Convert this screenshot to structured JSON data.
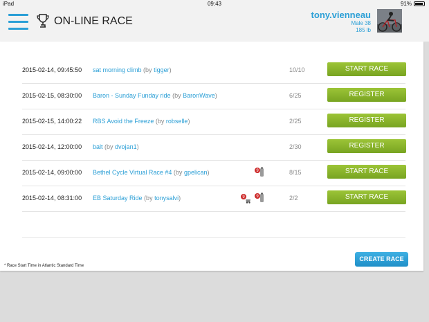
{
  "status_bar": {
    "carrier": "iPad",
    "time": "09:43",
    "battery": "91%"
  },
  "header": {
    "title": "ON-LINE RACE"
  },
  "user": {
    "name": "tony.vienneau",
    "line1": "Male 38",
    "line2": "185 lb"
  },
  "races": [
    {
      "date": "2015-02-14, 09:45:50",
      "name": "sat morning climb",
      "by_prefix": "(by ",
      "by_user": "tigger",
      "by_suffix": ")",
      "count": "10/10",
      "action": "START RACE",
      "icons": []
    },
    {
      "date": "2015-02-15, 08:30:00",
      "name": "Baron - Sunday Funday ride",
      "by_prefix": "(by ",
      "by_user": "BaronWave",
      "by_suffix": ")",
      "count": "6/25",
      "action": "REGISTER",
      "icons": []
    },
    {
      "date": "2015-02-15, 14:00:22",
      "name": "RBS Avoid the Freeze",
      "by_prefix": "(by ",
      "by_user": "robselle",
      "by_suffix": ")",
      "count": "2/25",
      "action": "REGISTER",
      "icons": []
    },
    {
      "date": "2015-02-14, 12:00:00",
      "name": "balt",
      "by_prefix": "(by ",
      "by_user": "dvojan1",
      "by_suffix": ")",
      "count": "2/30",
      "action": "REGISTER",
      "icons": []
    },
    {
      "date": "2015-02-14, 09:00:00",
      "name": "Bethel Cycle Virtual Race #4",
      "by_prefix": "(by ",
      "by_user": "gpelican",
      "by_suffix": ")",
      "count": "8/15",
      "action": "START RACE",
      "icons": [
        "bottle-icon"
      ]
    },
    {
      "date": "2015-02-14, 08:31:00",
      "name": "EB Saturday Ride",
      "by_prefix": "(by ",
      "by_user": "tonysalvi",
      "by_suffix": ")",
      "count": "2/2",
      "action": "START RACE",
      "icons": [
        "speed-icon",
        "bottle-icon"
      ]
    }
  ],
  "footnote": "* Race Start Time in Atlantic Standard Time",
  "create_button": "CREATE RACE",
  "colors": {
    "accent": "#2b9fd6",
    "action_green": "#8ab82c"
  }
}
